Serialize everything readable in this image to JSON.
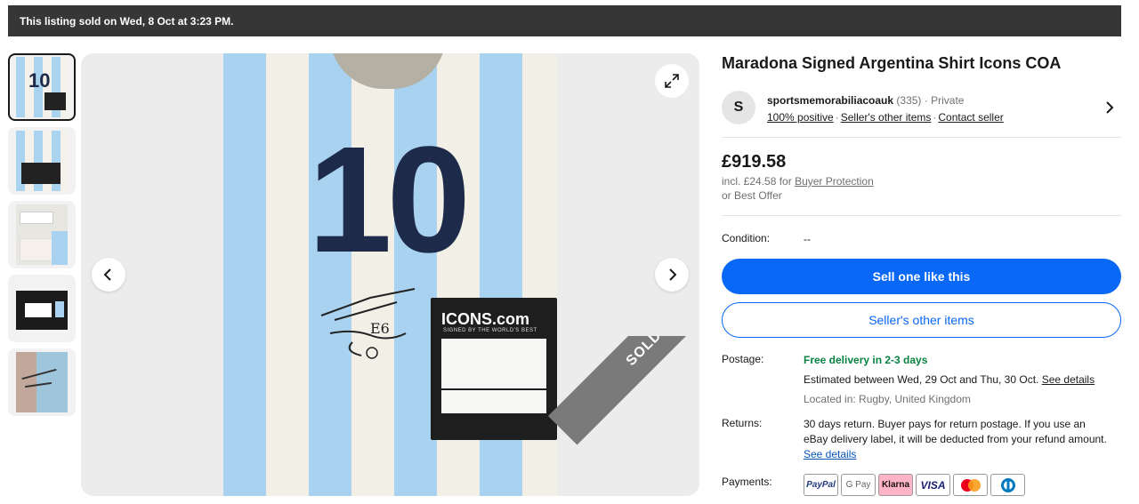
{
  "banner": {
    "text": "This listing sold on Wed, 8 Oct at 3:23 PM."
  },
  "gallery": {
    "thumbnails": [
      "shirt-front",
      "shirt-with-certificate",
      "certificate-closeup",
      "icons-box",
      "signature-closeup"
    ],
    "selected_index": 0,
    "shirt_number": "10",
    "coa_brand": "ICONS.com",
    "coa_tagline": "SIGNED BY THE WORLD'S BEST",
    "sold_label": "SOLD",
    "icons": {
      "prev": "chevron-left-icon",
      "next": "chevron-right-icon",
      "expand": "expand-icon"
    }
  },
  "listing": {
    "title": "Maradona Signed Argentina Shirt Icons COA",
    "seller": {
      "initial": "S",
      "name": "sportsmemorabiliacoauk",
      "feedback_count": "(335)",
      "separator": "·",
      "type": "Private",
      "positive": "100% positive",
      "other_items": "Seller's other items",
      "contact": "Contact seller"
    },
    "price": "£919.58",
    "incl_prefix": "incl. £24.58 for",
    "buyer_protection": "Buyer Protection",
    "best_offer": "or Best Offer",
    "condition_label": "Condition:",
    "condition_value": "--",
    "sell_button": "Sell one like this",
    "other_items_button": "Seller's other items",
    "postage": {
      "label": "Postage:",
      "delivery": "Free delivery in 2-3 days",
      "estimate": "Estimated between Wed, 29 Oct and Thu, 30 Oct.",
      "see_details": "See details",
      "location": "Located in: Rugby, United Kingdom"
    },
    "returns": {
      "label": "Returns:",
      "text": "30 days return. Buyer pays for return postage. If you use an eBay delivery label, it will be deducted from your refund amount.",
      "see_details": "See details"
    },
    "payments": {
      "label": "Payments:",
      "methods": [
        "PayPal",
        "G Pay",
        "Klarna",
        "VISA",
        "",
        ""
      ]
    }
  },
  "colors": {
    "primary": "#0968f6",
    "banner_bg": "#363636",
    "green": "#05823f",
    "link": "#0654ba"
  }
}
